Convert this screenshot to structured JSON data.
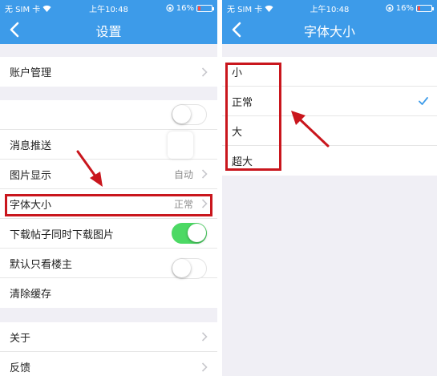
{
  "status_bar": {
    "carrier": "无 SIM 卡",
    "time": "上午10:48",
    "battery": "16%",
    "battery_level": 0.16
  },
  "left_screen": {
    "title": "设置",
    "rows": {
      "account": "账户管理",
      "push": "消息推送",
      "image_display": "图片显示",
      "image_display_value": "自动",
      "font_size": "字体大小",
      "font_size_value": "正常",
      "download_images": "下载帖子同时下载图片",
      "default_op_only": "默认只看楼主",
      "clear_cache": "清除缓存",
      "about": "关于",
      "feedback": "反馈"
    },
    "toggles": {
      "push": false,
      "download_images": true,
      "default_op_only": false
    }
  },
  "right_screen": {
    "title": "字体大小",
    "options": [
      "小",
      "正常",
      "大",
      "超大"
    ],
    "selected": "正常"
  },
  "colors": {
    "nav_bg": "#3d9be9",
    "highlight": "#c9161d",
    "toggle_on": "#4cd964",
    "check": "#3d9be9"
  }
}
